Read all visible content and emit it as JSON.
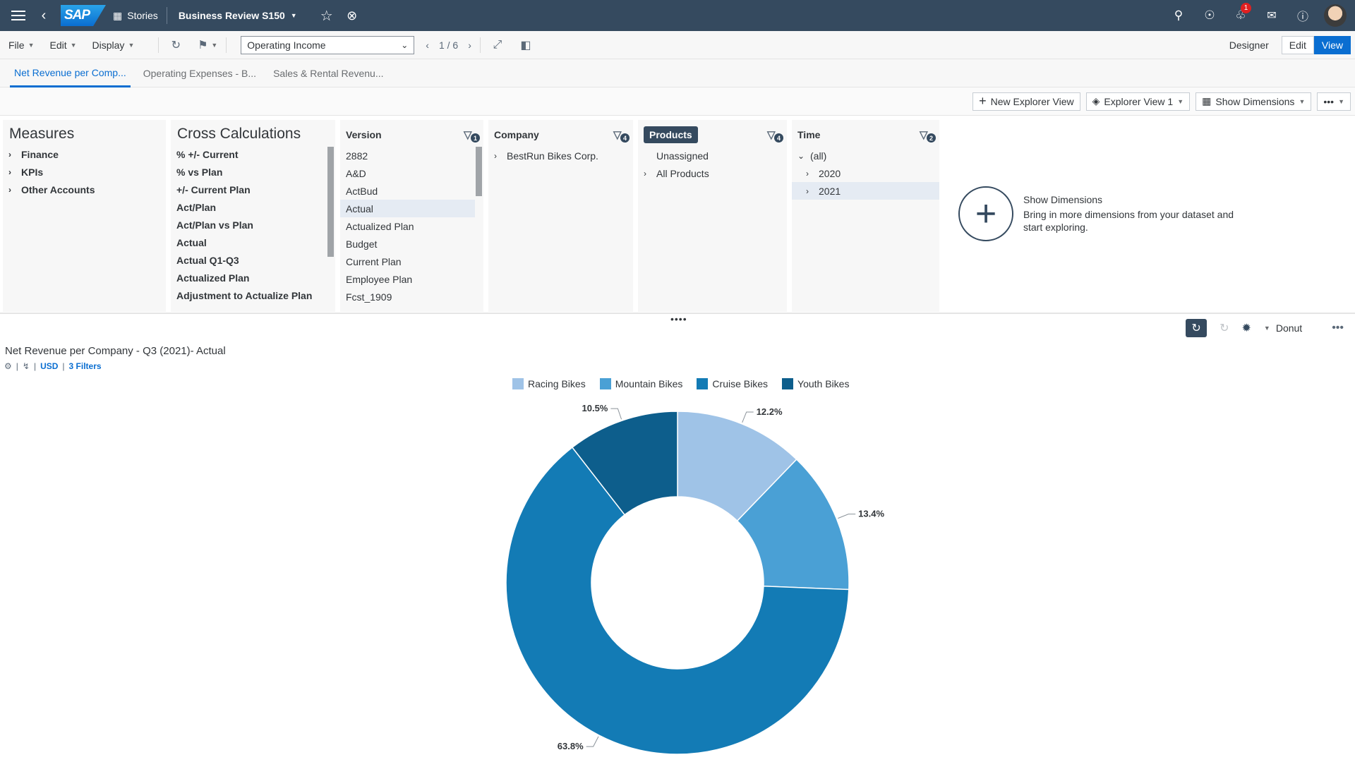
{
  "shell": {
    "logo": "SAP",
    "stories": "Stories",
    "title": "Business Review S150",
    "notifications": "1"
  },
  "toolbar": {
    "file": "File",
    "edit": "Edit",
    "display": "Display",
    "page_select": "Operating Income",
    "pager": "1 / 6",
    "designer": "Designer",
    "edit_btn": "Edit",
    "view_btn": "View"
  },
  "tabs": [
    {
      "label": "Net Revenue per Comp..."
    },
    {
      "label": "Operating Expenses - B..."
    },
    {
      "label": "Sales & Rental Revenu..."
    }
  ],
  "explorer": {
    "new_view": "New Explorer View",
    "view": "Explorer View 1",
    "show_dims": "Show Dimensions"
  },
  "measures": {
    "title": "Measures",
    "items": [
      "Finance",
      "KPIs",
      "Other Accounts"
    ]
  },
  "cross": {
    "title": "Cross Calculations",
    "items": [
      "% +/- Current",
      "% vs Plan",
      "+/- Current Plan",
      "Act/Plan",
      "Act/Plan vs Plan",
      "Actual",
      "Actual Q1-Q3",
      "Actualized Plan",
      "Adjustment to Actualize Plan"
    ]
  },
  "version": {
    "title": "Version",
    "filter_count": "1",
    "items": [
      "2882",
      "A&D",
      "ActBud",
      "Actual",
      "Actualized Plan",
      "Budget",
      "Current Plan",
      "Employee Plan",
      "Fcst_1909"
    ]
  },
  "company": {
    "title": "Company",
    "filter_count": "4",
    "items": [
      "BestRun Bikes Corp."
    ]
  },
  "products": {
    "title": "Products",
    "filter_count": "4",
    "items": [
      "Unassigned",
      "All Products"
    ]
  },
  "time": {
    "title": "Time",
    "filter_count": "2",
    "items": [
      "(all)",
      "2020",
      "2021"
    ]
  },
  "show_dimensions": {
    "title": "Show Dimensions",
    "desc": "Bring in more dimensions from your dataset and start exploring."
  },
  "chart_toolbar": {
    "type_label": "Donut"
  },
  "chart_header": {
    "title": "Net Revenue per Company -  Q3 (2021)- Actual",
    "currency": "USD",
    "filters": "3 Filters"
  },
  "chart_data": {
    "type": "pie",
    "donut": true,
    "categories": [
      "Racing Bikes",
      "Mountain Bikes",
      "Cruise Bikes",
      "Youth Bikes"
    ],
    "values": [
      12.2,
      13.4,
      63.8,
      10.5
    ],
    "labels": [
      "12.2%",
      "13.4%",
      "63.8%",
      "10.5%"
    ],
    "colors": [
      "#9fc3e7",
      "#4aa0d5",
      "#137bb5",
      "#0d5e8c"
    ],
    "legend": "top"
  }
}
